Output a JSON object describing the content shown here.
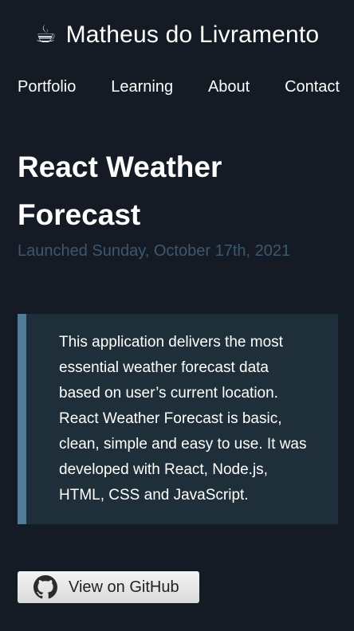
{
  "header": {
    "icon": "coffee-cup-icon",
    "icon_glyph": "☕",
    "title": "Matheus do Livramento"
  },
  "nav": {
    "items": [
      {
        "label": "Portfolio"
      },
      {
        "label": "Learning"
      },
      {
        "label": "About"
      },
      {
        "label": "Contact"
      }
    ]
  },
  "post": {
    "title": "React Weather Forecast",
    "date": "Launched Sunday, October 17th, 2021",
    "description": "This application delivers the most essential weather forecast data based on user’s current location. React Weather Forecast is basic, clean, simple and easy to use. It was developed with React, Node.js, HTML, CSS and JavaScript."
  },
  "github_button": {
    "label": "View on GitHub",
    "icon": "github-icon"
  },
  "colors": {
    "background": "#141b24",
    "date_text": "#3b5870",
    "quote_background": "#1f2f3a",
    "quote_border": "#4f7c96"
  }
}
